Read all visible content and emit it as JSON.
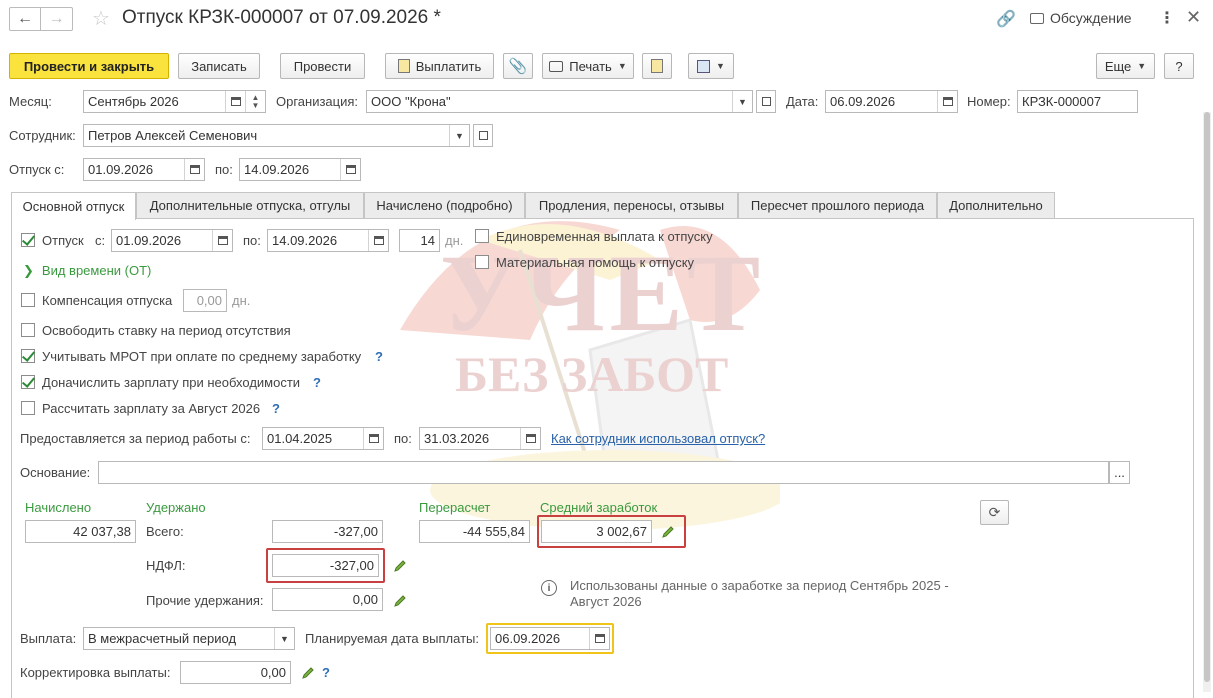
{
  "header": {
    "title": "Отпуск КРЗК-000007 от 07.09.2026 *",
    "discussion_label": "Обсуждение"
  },
  "toolbar": {
    "post_close": "Провести и закрыть",
    "save": "Записать",
    "post": "Провести",
    "pay": "Выплатить",
    "print": "Печать",
    "more": "Еще",
    "help": "?"
  },
  "fields": {
    "month_label": "Месяц:",
    "month_value": "Сентябрь 2026",
    "org_label": "Организация:",
    "org_value": "ООО \"Крона\"",
    "date_label": "Дата:",
    "date_value": "06.09.2026",
    "number_label": "Номер:",
    "number_value": "КРЗК-000007",
    "employee_label": "Сотрудник:",
    "employee_value": "Петров Алексей Семенович",
    "vac_from_label": "Отпуск с:",
    "vac_from_value": "01.09.2026",
    "vac_to_label": "по:",
    "vac_to_value": "14.09.2026"
  },
  "tabs": [
    {
      "label": "Основной отпуск"
    },
    {
      "label": "Дополнительные отпуска, отгулы"
    },
    {
      "label": "Начислено (подробно)"
    },
    {
      "label": "Продления, переносы, отзывы"
    },
    {
      "label": "Пересчет прошлого периода"
    },
    {
      "label": "Дополнительно"
    }
  ],
  "main": {
    "vacation_label": "Отпуск",
    "vacation_from_label": "с:",
    "vacation_from": "01.09.2026",
    "vacation_to_label": "по:",
    "vacation_to": "14.09.2026",
    "days": "14",
    "days_unit": "дн.",
    "lump_sum": "Единовременная выплата к отпуску",
    "material_aid": "Материальная помощь к отпуску",
    "time_type": "Вид времени (ОТ)",
    "compensation": "Компенсация отпуска",
    "compensation_value": "0,00",
    "compensation_unit": "дн.",
    "free_rate": "Освободить ставку на период отсутствия",
    "mrot": "Учитывать МРОТ при оплате по среднему заработку",
    "accrue_salary": "Доначислить зарплату при необходимости",
    "calc_salary": "Рассчитать зарплату за Август 2026",
    "period_label": "Предоставляется за период работы с:",
    "period_from": "01.04.2025",
    "period_to_label": "по:",
    "period_to": "31.03.2026",
    "period_link": "Как сотрудник использовал отпуск?",
    "basis_label": "Основание:",
    "basis_value": "",
    "basis_btn": "...",
    "accrued_title": "Начислено",
    "accrued_value": "42 037,38",
    "withheld_title": "Удержано",
    "withheld_total_label": "Всего:",
    "withheld_total": "-327,00",
    "ndfl_label": "НДФЛ:",
    "ndfl_value": "-327,00",
    "other_label": "Прочие удержания:",
    "other_value": "0,00",
    "recalc_title": "Перерасчет",
    "recalc_value": "-44 555,84",
    "avg_title": "Средний заработок",
    "avg_value": "3 002,67",
    "info_text_1": "Использованы данные о заработке за период Сентябрь 2025 -",
    "info_text_2": "Август 2026",
    "payout_label": "Выплата:",
    "payout_value": "В межрасчетный период",
    "plan_date_label": "Планируемая дата выплаты:",
    "plan_date_value": "06.09.2026",
    "adjust_label": "Корректировка выплаты:",
    "adjust_value": "0,00"
  },
  "watermark": {
    "line1": "УЧЕТ",
    "line2": "БЕЗ ЗАБОТ"
  },
  "colors": {
    "primary": "#fbe33e",
    "accent_green": "#3a9a3f",
    "highlight_red": "#c94040",
    "highlight_yellow": "#f0c419",
    "link": "#2962a8"
  }
}
